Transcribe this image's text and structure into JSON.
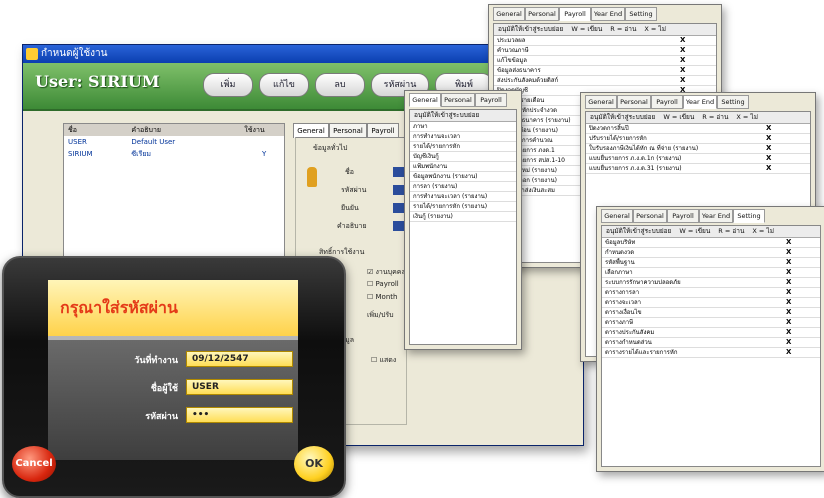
{
  "window": {
    "title": "กำหนดผู้ใช้งาน",
    "user_label": "User: SIRIUM",
    "toolbar": [
      "เพิ่ม",
      "แก้ไข",
      "ลบ",
      "รหัสผ่าน",
      "พิมพ์"
    ]
  },
  "user_list": {
    "headers": [
      "ชื่อ",
      "คำอธิบาย",
      "ใช้งาน"
    ],
    "rows": [
      {
        "name": "USER",
        "desc": "Default User",
        "active": ""
      },
      {
        "name": "SIRIUM",
        "desc": "ซีเรียม",
        "active": "Y"
      }
    ]
  },
  "detail_tabs": [
    "General",
    "Personal",
    "Payroll"
  ],
  "detail_labels": {
    "group1": "ข้อมูลทั่วไป",
    "name": "ชื่อ",
    "code": "รหัสผ่าน",
    "confirm": "ยืนยัน",
    "desc": "คำอธิบาย",
    "group2": "สิทธิ์การใช้งาน",
    "chk1": "งานบุคคล",
    "chk2": "Payroll",
    "chk3": "Month",
    "chk4": "เพิ่ม/ปรับ",
    "group3": "สิทธิ์ข้อมูล",
    "chk5": "แสดง"
  },
  "login": {
    "title": "กรุณาใส่รหัสผ่าน",
    "date_label": "วันที่ทำงาน",
    "date_value": "09/12/2547",
    "user_label": "ชื่อผู้ใช้",
    "user_value": "USER",
    "pass_label": "รหัสผ่าน",
    "pass_value": "•••",
    "cancel": "Cancel",
    "ok": "OK"
  },
  "panel_header": {
    "title": "อนุมัติให้เข้าสู่ระบบย่อย",
    "w": "W = เขียน",
    "r": "R = อ่าน",
    "x": "X = ไม่"
  },
  "panels": [
    {
      "tabs": [
        "General",
        "Personal",
        "Payroll",
        "Year End",
        "Setting"
      ],
      "active": 2,
      "rows": [
        {
          "label": "ประมวลผล",
          "x": "X"
        },
        {
          "label": "คำนวณภาษี",
          "x": "X"
        },
        {
          "label": "แก้ไขข้อมูล",
          "x": "X"
        },
        {
          "label": "ข้อมูลส่งธนาคาร",
          "x": "X"
        },
        {
          "label": "ส่งประกันสังคมด้วยดิสก์",
          "x": "X"
        },
        {
          "label": "ปิดงวดบัญชี",
          "x": "X"
        },
        {
          "label": "คืนข้อมูลรายเดือน",
          "x": ""
        },
        {
          "label": "เงินได้เงินหักประจำงวด",
          "x": ""
        },
        {
          "label": "ใบนำฝากธนาคาร (รายงาน)",
          "x": ""
        },
        {
          "label": "สลิปเงินเดือน (รายงาน)",
          "x": ""
        },
        {
          "label": "ข้อมูลเพื่อการคำนวณ",
          "x": ""
        },
        {
          "label": "แบบยื่นรายการ ภงด.1",
          "x": ""
        },
        {
          "label": "แบบยื่นรายการ สปส.1-10",
          "x": ""
        },
        {
          "label": "พนักงานใหม่ (รายงาน)",
          "x": ""
        },
        {
          "label": "พนักงานออก (รายงาน)",
          "x": ""
        },
        {
          "label": "รายการนำส่งเงินสะสม",
          "x": ""
        }
      ]
    },
    {
      "tabs": [
        "General",
        "Personal",
        "Payroll"
      ],
      "active": 0,
      "rows": [
        {
          "label": "ภาษา"
        },
        {
          "label": "การทำงานจะเวลา"
        },
        {
          "label": "รายได้/รายการหัก"
        },
        {
          "label": "บัญชีเงินกู้"
        },
        {
          "label": "แฟ้มพนักงาน"
        },
        {
          "label": "ข้อมูลพนักงาน (รายงาน)"
        },
        {
          "label": "การลา (รายงาน)"
        },
        {
          "label": "การทำงานจะเวลา (รายงาน)"
        },
        {
          "label": "รายได้/รายการหัก (รายงาน)"
        },
        {
          "label": "เงินกู้ (รายงาน)"
        }
      ]
    },
    {
      "tabs": [
        "General",
        "Personal",
        "Payroll",
        "Year End",
        "Setting"
      ],
      "active": 3,
      "rows": [
        {
          "label": "ปิดงวดการสิ้นปี",
          "x": "X"
        },
        {
          "label": "ปรับรายได้/รายการหัก",
          "x": "X"
        },
        {
          "label": "ใบรับรองภาษีเงินได้หัก ณ ที่จ่าย (รายงาน)",
          "x": "X"
        },
        {
          "label": "แบบยื่นรายการ ภ.ง.ด.1ก (รายงาน)",
          "x": "X"
        },
        {
          "label": "แบบยื่นรายการ ภ.ง.ด.31 (รายงาน)",
          "x": "X"
        }
      ]
    },
    {
      "tabs": [
        "General",
        "Personal",
        "Payroll",
        "Year End",
        "Setting"
      ],
      "active": 4,
      "rows": [
        {
          "label": "ข้อมูลบริษัท",
          "x": "X"
        },
        {
          "label": "กำหนดงวด",
          "x": "X"
        },
        {
          "label": "รหัสพื้นฐาน",
          "x": "X"
        },
        {
          "label": "เลือกภาษา",
          "x": "X"
        },
        {
          "label": "ระบบการรักษาความปลอดภัย",
          "x": "X"
        },
        {
          "label": "ตารางการลา",
          "x": "X"
        },
        {
          "label": "ตารางจะเวลา",
          "x": "X"
        },
        {
          "label": "ตารางเงื่อนไข",
          "x": "X"
        },
        {
          "label": "ตารางภาษี",
          "x": "X"
        },
        {
          "label": "ตารางประกันสังคม",
          "x": "X"
        },
        {
          "label": "ตารางกำหนดส่วน",
          "x": "X"
        },
        {
          "label": "ตารางรายได้และรายการหัก",
          "x": "X"
        }
      ]
    }
  ]
}
